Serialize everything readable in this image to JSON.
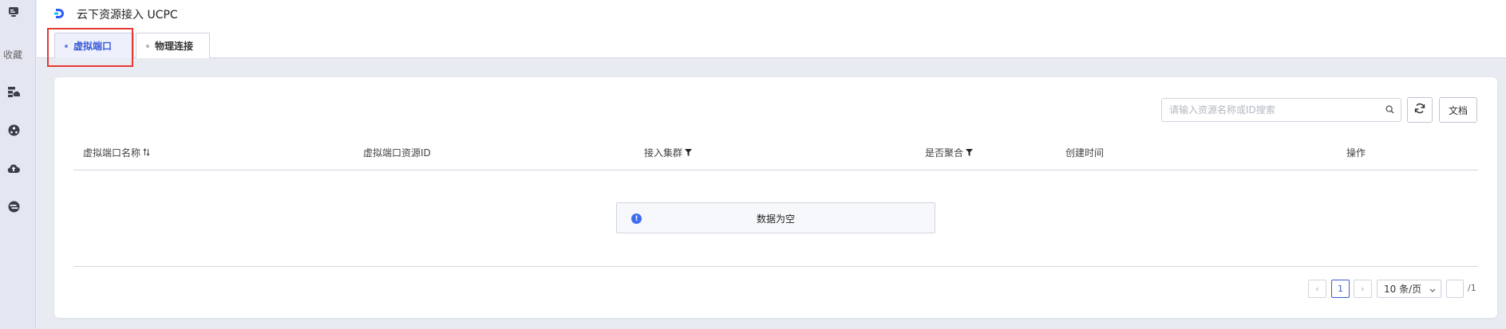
{
  "sidebar": {
    "favorites_label": "收藏",
    "icons": [
      "monitor-icon",
      "server-cloud-icon",
      "network-globe-icon",
      "cloud-upload-icon",
      "connection-icon"
    ]
  },
  "header": {
    "title": "云下资源接入 UCPC",
    "tabs": [
      {
        "label": "虚拟端口",
        "active": true
      },
      {
        "label": "物理连接",
        "active": false
      }
    ]
  },
  "toolbar": {
    "search_placeholder": "请输入资源名称或ID搜索",
    "doc_label": "文档"
  },
  "table": {
    "columns": [
      {
        "label": "虚拟端口名称",
        "icon": "sort-icon"
      },
      {
        "label": "虚拟端口资源ID"
      },
      {
        "label": "接入集群",
        "icon": "filter-icon"
      },
      {
        "label": "是否聚合",
        "icon": "filter-icon"
      },
      {
        "label": "创建时间"
      },
      {
        "label": "操作"
      }
    ],
    "empty_text": "数据为空"
  },
  "pagination": {
    "current_page": "1",
    "page_size_label": "10 条/页",
    "total_pages": "/1"
  },
  "colors": {
    "accent": "#3a5bd9",
    "highlight": "#e53935"
  }
}
